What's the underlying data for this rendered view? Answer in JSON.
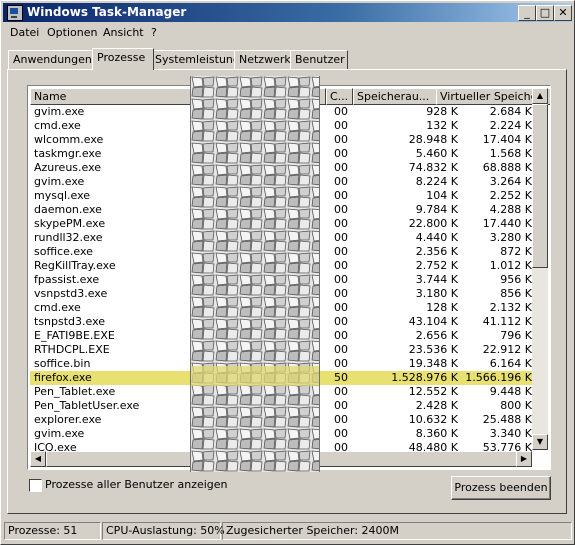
{
  "window": {
    "title": "Windows Task-Manager"
  },
  "menu": [
    "Datei",
    "Optionen",
    "Ansicht",
    "?"
  ],
  "tabs": [
    "Anwendungen",
    "Prozesse",
    "Systemleistung",
    "Netzwerk",
    "Benutzer"
  ],
  "columns": {
    "name": "Name",
    "cpu": "C...",
    "mem": "Speicherau...",
    "virt": "Virtueller Speiche"
  },
  "processes": [
    {
      "name": "gvim.exe",
      "cpu": "00",
      "mem": "928 K",
      "virt": "2.684 K"
    },
    {
      "name": "cmd.exe",
      "cpu": "00",
      "mem": "132 K",
      "virt": "2.224 K"
    },
    {
      "name": "wlcomm.exe",
      "cpu": "00",
      "mem": "28.948 K",
      "virt": "17.404 K"
    },
    {
      "name": "taskmgr.exe",
      "cpu": "00",
      "mem": "5.460 K",
      "virt": "1.568 K"
    },
    {
      "name": "Azureus.exe",
      "cpu": "00",
      "mem": "74.832 K",
      "virt": "68.888 K"
    },
    {
      "name": "gvim.exe",
      "cpu": "00",
      "mem": "8.224 K",
      "virt": "3.264 K"
    },
    {
      "name": "mysql.exe",
      "cpu": "00",
      "mem": "104 K",
      "virt": "2.252 K"
    },
    {
      "name": "daemon.exe",
      "cpu": "00",
      "mem": "9.784 K",
      "virt": "4.288 K"
    },
    {
      "name": "skypePM.exe",
      "cpu": "00",
      "mem": "22.800 K",
      "virt": "17.440 K"
    },
    {
      "name": "rundll32.exe",
      "cpu": "00",
      "mem": "4.440 K",
      "virt": "3.280 K"
    },
    {
      "name": "soffice.exe",
      "cpu": "00",
      "mem": "2.356 K",
      "virt": "872 K"
    },
    {
      "name": "RegKillTray.exe",
      "cpu": "00",
      "mem": "2.752 K",
      "virt": "1.012 K"
    },
    {
      "name": "fpassist.exe",
      "cpu": "00",
      "mem": "3.744 K",
      "virt": "956 K"
    },
    {
      "name": "vsnpstd3.exe",
      "cpu": "00",
      "mem": "3.180 K",
      "virt": "856 K"
    },
    {
      "name": "cmd.exe",
      "cpu": "00",
      "mem": "128 K",
      "virt": "2.132 K"
    },
    {
      "name": "tsnpstd3.exe",
      "cpu": "00",
      "mem": "43.104 K",
      "virt": "41.112 K"
    },
    {
      "name": "E_FATI9BE.EXE",
      "cpu": "00",
      "mem": "2.656 K",
      "virt": "796 K"
    },
    {
      "name": "RTHDCPL.EXE",
      "cpu": "00",
      "mem": "23.536 K",
      "virt": "22.912 K"
    },
    {
      "name": "soffice.bin",
      "cpu": "00",
      "mem": "19.348 K",
      "virt": "6.164 K"
    },
    {
      "name": "firefox.exe",
      "cpu": "50",
      "mem": "1.528.976 K",
      "virt": "1.566.196 K",
      "selected": true
    },
    {
      "name": "Pen_Tablet.exe",
      "cpu": "00",
      "mem": "12.552 K",
      "virt": "9.448 K"
    },
    {
      "name": "Pen_TabletUser.exe",
      "cpu": "00",
      "mem": "2.428 K",
      "virt": "800 K"
    },
    {
      "name": "explorer.exe",
      "cpu": "00",
      "mem": "10.632 K",
      "virt": "25.488 K"
    },
    {
      "name": "gvim.exe",
      "cpu": "00",
      "mem": "8.360 K",
      "virt": "3.340 K"
    },
    {
      "name": "ICQ.exe",
      "cpu": "00",
      "mem": "48.480 K",
      "virt": "53.776 K"
    }
  ],
  "footer": {
    "show_all_label": "Prozesse aller Benutzer anzeigen",
    "end_button": "Prozess beenden"
  },
  "status": {
    "processes": "Prozesse: 51",
    "cpu": "CPU-Auslastung: 50%",
    "memory": "Zugesicherter Speicher: 2400M"
  },
  "colors": {
    "titlebar": "#0a246a",
    "selected_row": "#e8e070",
    "face": "#d4d0c8"
  }
}
